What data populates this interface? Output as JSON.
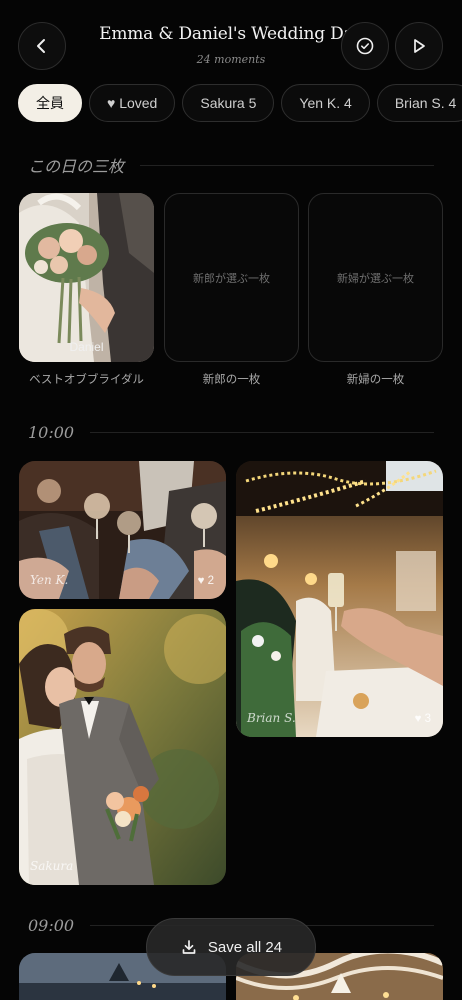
{
  "header": {
    "title": "Emma & Daniel's Wedding Day",
    "subtitle": "24 moments",
    "back_icon": "chevron-left-icon",
    "select_icon": "check-circle-icon",
    "play_icon": "play-icon"
  },
  "filters": [
    {
      "label": "全員",
      "active": true
    },
    {
      "label": "♥ Loved",
      "active": false
    },
    {
      "label": "Sakura 5",
      "active": false
    },
    {
      "label": "Yen K. 4",
      "active": false
    },
    {
      "label": "Brian S. 4",
      "active": false
    }
  ],
  "top_three": {
    "heading": "この日の三枚",
    "picks": [
      {
        "caption": "ベストオブブライダル",
        "photo_label": "Daniel"
      },
      {
        "caption": "新郎の一枚",
        "placeholder": "新郎が選ぶ一枚"
      },
      {
        "caption": "新婦の一枚",
        "placeholder": "新婦が選ぶ一枚"
      }
    ]
  },
  "time_groups": [
    {
      "time": "10:00",
      "photos": [
        {
          "author": "Yen K.",
          "likes": "♥ 2",
          "subject": "champagne toast"
        },
        {
          "author": "Brian S.",
          "likes": "♥ 3",
          "subject": "reception toast"
        },
        {
          "author": "Sakura",
          "likes": "",
          "subject": "couple portrait"
        }
      ]
    },
    {
      "time": "09:00"
    }
  ],
  "save_button": {
    "label": "Save all 24",
    "icon": "download-icon"
  },
  "colors": {
    "background": "#050505",
    "chip_active": "#f3efe6",
    "accent_warm": "#e8c46a"
  }
}
